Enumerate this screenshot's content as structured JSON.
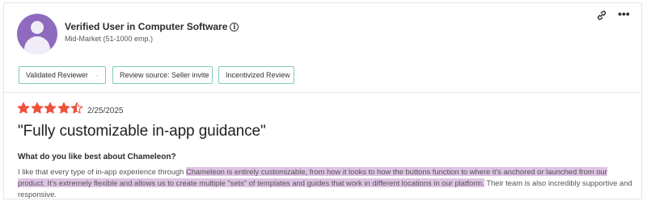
{
  "reviewer": {
    "name": "Verified User in Computer Software",
    "segment": "Mid-Market (51-1000 emp.)",
    "info_symbol": "i"
  },
  "actions": {
    "link_icon": "link-icon",
    "more_icon": "more-horizontal-icon",
    "more_symbol": "•••"
  },
  "badges": [
    {
      "label": "Validated Reviewer",
      "icon": "check-icon"
    },
    {
      "label": "Review source: Seller invite"
    },
    {
      "label": "Incentivized Review"
    }
  ],
  "review": {
    "rating": 4.5,
    "max_rating": 5,
    "star_color": "#f0503c",
    "date": "2/25/2025",
    "title": "\"Fully customizable in-app guidance\"",
    "question": "What do you like best about Chameleon?",
    "answer": {
      "before": "I like that every type of in-app experience through ",
      "highlighted": "Chameleon is entirely customizable, from how it looks to how the buttons function to where it's anchored or launched from our product. It's extremely flexible and allows us to create multiple \"sets\" of templates and guides that work in different locations in our platform.",
      "after": " Their team is also incredibly supportive and responsive.",
      "highlight_color": "#dec4e4"
    }
  },
  "colors": {
    "avatar": "#8e6bbf",
    "badge_border": "#7fcbbd",
    "check": "#3aa58f"
  }
}
